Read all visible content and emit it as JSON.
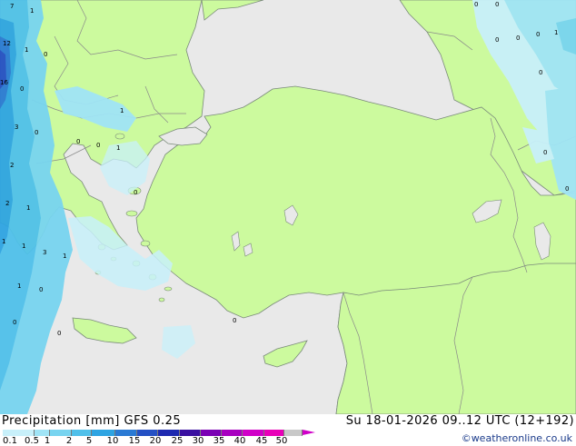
{
  "footer": {
    "title": "Precipitation [mm]  GFS 0.25",
    "datetime": "Su 18-01-2026 09..12 UTC (12+192)",
    "credit": "©weatheronline.co.uk"
  },
  "legend": {
    "ticks": [
      "0.1",
      "0.5",
      "1",
      "2",
      "5",
      "10",
      "15",
      "20",
      "25",
      "30",
      "35",
      "40",
      "45",
      "50"
    ],
    "colors": [
      "#c8f0fa",
      "#a0e4f6",
      "#78d4f0",
      "#50c0ea",
      "#2ea4e2",
      "#2a7ad4",
      "#2450c4",
      "#1e2ab0",
      "#3a10a0",
      "#7a00b4",
      "#a800c0",
      "#d000c8",
      "#e800b8",
      "#c8c8c8"
    ]
  },
  "map_colors": {
    "land": "#ccfa9e",
    "sea": "#e9e9e9",
    "coast": "#7a8a7a",
    "border": "#8a8a8a"
  },
  "point_labels": [
    "7",
    "1",
    "12",
    "1",
    "0",
    "16",
    "0",
    "1",
    "3",
    "0",
    "0",
    "0",
    "1",
    "2",
    "0",
    "2",
    "1",
    "1",
    "1",
    "3",
    "1",
    "1",
    "0",
    "0",
    "0",
    "0",
    "0",
    "0",
    "0",
    "0",
    "0",
    "1",
    "0",
    "0",
    "0"
  ]
}
